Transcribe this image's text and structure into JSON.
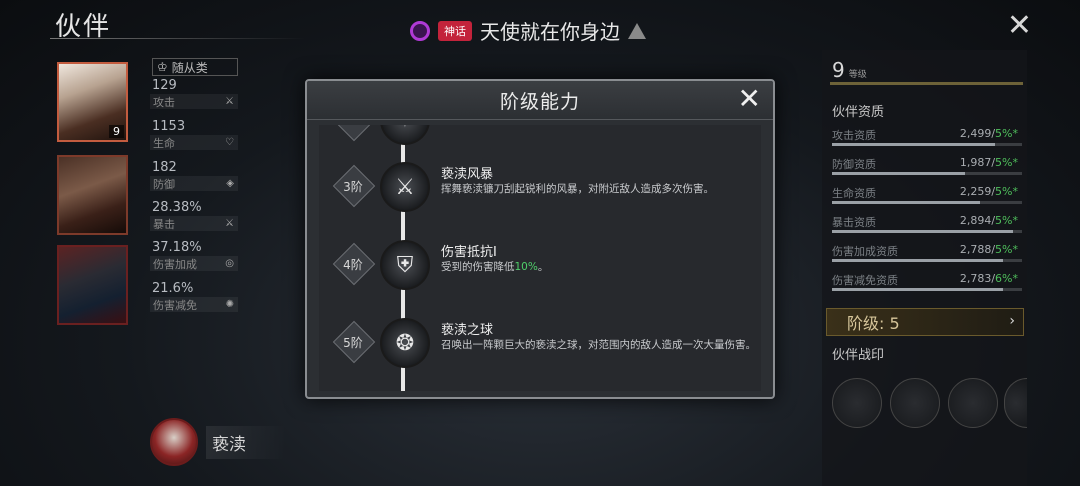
{
  "header": {
    "title": "伙伴",
    "notice_tag": "神话",
    "notice_text": "天使就在你身边",
    "close_icon": "close-icon"
  },
  "left": {
    "category": "随从类",
    "stats": [
      {
        "value": "129",
        "label": "攻击",
        "icon": "sword-slash-icon"
      },
      {
        "value": "1153",
        "label": "生命",
        "icon": "heart-icon"
      },
      {
        "value": "182",
        "label": "防御",
        "icon": "shield-icon"
      },
      {
        "value": "28.38%",
        "label": "暴击",
        "icon": "crit-slash-icon"
      },
      {
        "value": "37.18%",
        "label": "伤害加成",
        "icon": "swirl-icon"
      },
      {
        "value": "21.6%",
        "label": "伤害减免",
        "icon": "spark-icon"
      }
    ],
    "portrait_level": "9",
    "hero_name": "亵渎"
  },
  "right": {
    "level": "9",
    "level_unit": "等级",
    "aptitude_title": "伙伴资质",
    "aptitudes": [
      {
        "label": "攻击资质",
        "value": "2,499/",
        "pct": "5%",
        "plus": "*",
        "fill": 0.86
      },
      {
        "label": "防御资质",
        "value": "1,987/",
        "pct": "5%",
        "plus": "*",
        "fill": 0.7
      },
      {
        "label": "生命资质",
        "value": "2,259/",
        "pct": "5%",
        "plus": "*",
        "fill": 0.78
      },
      {
        "label": "暴击资质",
        "value": "2,894/",
        "pct": "5%",
        "plus": "*",
        "fill": 0.95
      },
      {
        "label": "伤害加成资质",
        "value": "2,788/",
        "pct": "5%",
        "plus": "*",
        "fill": 0.9
      },
      {
        "label": "伤害减免资质",
        "value": "2,783/",
        "pct": "6%",
        "plus": "*",
        "fill": 0.9
      }
    ],
    "tier_button": "阶级: 5",
    "seal_title": "伙伴战印"
  },
  "modal": {
    "title": "阶级能力",
    "tiers": [
      {
        "tier": "3阶",
        "name": "亵渎风暴",
        "desc_pre": "挥舞亵渎镰刀刮起锐利的风暴，对附近敌人造成多次伤害。",
        "desc_hl": "",
        "desc_post": "",
        "icon": "storm-blade-icon"
      },
      {
        "tier": "4阶",
        "name": "伤害抵抗I",
        "desc_pre": "受到的伤害降低",
        "desc_hl": "10%",
        "desc_post": "。",
        "icon": "shield-trident-icon"
      },
      {
        "tier": "5阶",
        "name": "亵渎之球",
        "desc_pre": "召唤出一阵颗巨大的亵渎之球，对范围内的敌人造成一次大量伤害。",
        "desc_hl": "",
        "desc_post": "",
        "icon": "dark-orb-icon"
      }
    ]
  }
}
